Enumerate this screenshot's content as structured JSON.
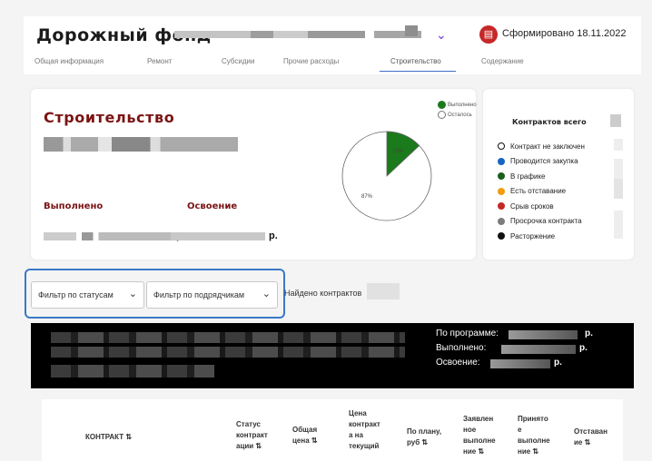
{
  "header": {
    "title": "Дорожный фонд",
    "generated": "Сформировано 18.11.2022",
    "tabs": [
      "Общая информация",
      "Ремонт",
      "Субсидии",
      "Прочие расходы",
      "Строительство",
      "Содержание"
    ],
    "active_tab": "Строительство"
  },
  "construction": {
    "title": "Строительство",
    "done_label": "Выполнено",
    "mastered_label": "Освоение",
    "currency": "р."
  },
  "pie": {
    "legend": [
      "Выполнено",
      "Осталось"
    ],
    "done_pct_label": "13%",
    "left_pct_label": "87%",
    "done_fraction": 0.13,
    "done_color": "#1b7a1b",
    "left_color": "#ffffff"
  },
  "contracts": {
    "title": "Контрактов всего",
    "statuses": [
      {
        "label": "Контракт не заключен",
        "color": "#ffffff"
      },
      {
        "label": "Проводится закупка",
        "color": "#1565c0"
      },
      {
        "label": "В графике",
        "color": "#1b5e20"
      },
      {
        "label": "Есть отставание",
        "color": "#f39c12"
      },
      {
        "label": "Срыв сроков",
        "color": "#c62828"
      },
      {
        "label": "Просрочка контракта",
        "color": "#7d7d7d"
      },
      {
        "label": "Расторжение",
        "color": "#111111"
      }
    ]
  },
  "filters": {
    "status_placeholder": "Фильтр по статусам",
    "contractor_placeholder": "Фильтр по подрядчикам",
    "found_label": "Найдено контрактов"
  },
  "summary": {
    "program_label": "По программе:",
    "done_label": "Выполнено:",
    "mastered_label": "Освоение:",
    "currency": "р."
  },
  "table": {
    "columns": [
      "КОНТРАКТ ⇅",
      "Статус контракт ации ⇅",
      "Общая цена ⇅",
      "Цена контракт а на текущий",
      "По плану, руб ⇅",
      "Заявлен ное выполне ние ⇅",
      "Принято е выполне ние ⇅",
      "Отставан ие ⇅"
    ]
  },
  "colors": {
    "accent": "#7b1313",
    "tab_active": "#3f6fc5",
    "filter_highlight": "#3b79c8"
  }
}
